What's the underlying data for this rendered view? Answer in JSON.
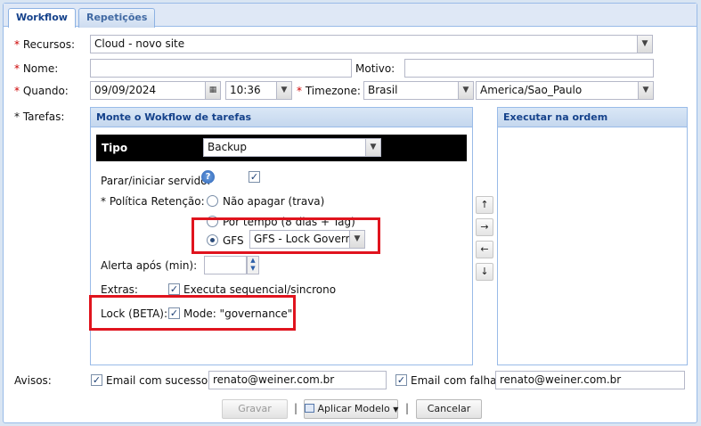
{
  "tabs": [
    {
      "label": "Workflow",
      "active": true
    },
    {
      "label": "Repetições",
      "active": false
    }
  ],
  "form": {
    "recursos": {
      "label": "Recursos:",
      "value": "Cloud - novo site"
    },
    "nome": {
      "label": "Nome:",
      "value": ""
    },
    "motivo": {
      "label": "Motivo:",
      "value": ""
    },
    "quando": {
      "label": "Quando:",
      "date": "09/09/2024",
      "time": "10:36"
    },
    "timezone": {
      "label": "Timezone:",
      "country": "Brasil",
      "zone": "America/Sao_Paulo"
    },
    "tarefas": {
      "label": "* Tarefas:"
    },
    "required_mark": "*"
  },
  "workflow_panel": {
    "title": "Monte o Wokflow de tarefas",
    "tipo_label": "Tipo",
    "tipo_value": "Backup",
    "parar_label": "Parar/iniciar servidor",
    "parar_checked": true,
    "help_glyph": "?",
    "politica_label": "* Política Retenção:",
    "politica_options": [
      {
        "label": "Não apagar (trava)",
        "selected": false
      },
      {
        "label": "Por tempo (8 dias + Tag)",
        "selected": false
      },
      {
        "label": "GFS",
        "selected": true
      }
    ],
    "gfs_select": "GFS - Lock Governa",
    "alerta_label": "Alerta após (min):",
    "alerta_value": "",
    "extras_label": "Extras:",
    "extras_option": "Executa sequencial/sincrono",
    "extras_checked": true,
    "lock_label": "Lock (BETA):",
    "lock_option": "Mode: \"governance\"",
    "lock_checked": true
  },
  "order_panel": {
    "title": "Executar na ordem"
  },
  "arrows": [
    "↑",
    "→",
    "←",
    "↓"
  ],
  "avisos": {
    "label": "Avisos:",
    "sucesso_label": "Email com sucesso",
    "sucesso_checked": true,
    "sucesso_email": "renato@weiner.com.br",
    "falha_label": "Email com falha",
    "falha_checked": true,
    "falha_email": "renato@weiner.com.br"
  },
  "buttons": {
    "gravar": "Gravar",
    "aplicar": "Aplicar Modelo",
    "cancelar": "Cancelar",
    "separator": "|"
  },
  "icons": {
    "check": "✓",
    "dropdown": "▼",
    "calendar": "calendar-icon"
  },
  "colors": {
    "highlight": "#e0141e",
    "panel_header": "#15428b",
    "required": "#cc0000"
  }
}
